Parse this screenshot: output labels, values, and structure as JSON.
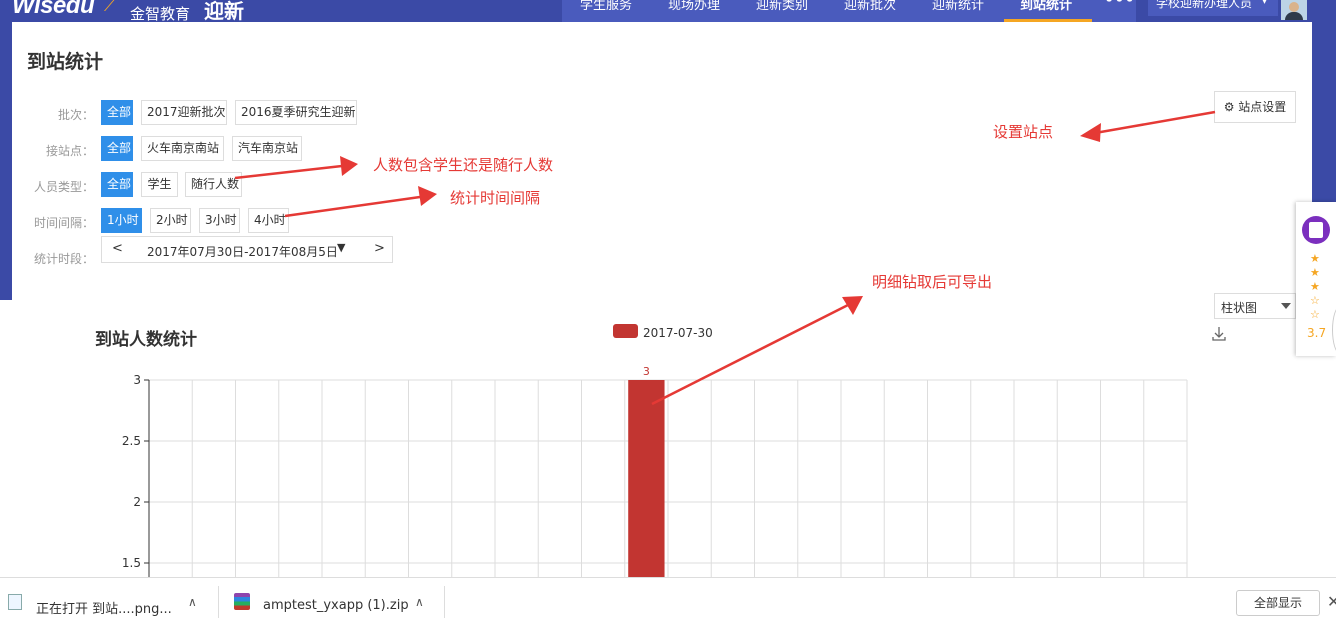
{
  "header": {
    "logo": "Wisedu",
    "logo_cn": "金智教育",
    "app_title": "迎新",
    "nav": [
      "学生服务",
      "现场办理",
      "迎新类别",
      "迎新批次",
      "迎新统计",
      "到站统计"
    ],
    "active_nav": "到站统计",
    "more": "•••",
    "user": "学校迎新办理人员",
    "user_caret": "▾"
  },
  "page": {
    "title": "到站统计",
    "filters": {
      "batch": {
        "label": "批次：",
        "options": [
          "全部",
          "2017迎新批次",
          "2016夏季研究生迎新"
        ],
        "selected": "全部"
      },
      "station": {
        "label": "接站点：",
        "options": [
          "全部",
          "火车南京南站",
          "汽车南京站"
        ],
        "selected": "全部"
      },
      "person_type": {
        "label": "人员类型：",
        "options": [
          "全部",
          "学生",
          "随行人数"
        ],
        "selected": "全部"
      },
      "interval": {
        "label": "时间间隔：",
        "options": [
          "1小时",
          "2小时",
          "3小时",
          "4小时"
        ],
        "selected": "1小时"
      },
      "period": {
        "label": "统计时段：",
        "prev": "<",
        "range": "2017年07月30日-2017年08月5日",
        "caret": "▼",
        "next": ">"
      }
    },
    "site_settings_button": "站点设置",
    "chart_type_select": "柱状图"
  },
  "annotations": {
    "site": "设置站点",
    "person_type": "人数包含学生还是随行人数",
    "interval": "统计时间间隔",
    "drill": "明细钻取后可导出"
  },
  "chart_data": {
    "type": "bar",
    "title": "到站人数统计",
    "legend": [
      "2017-07-30"
    ],
    "series": [
      {
        "name": "2017-07-30",
        "color": "#c23531",
        "values": [
          0,
          0,
          0,
          0,
          0,
          0,
          0,
          0,
          0,
          0,
          0,
          3,
          0,
          0,
          0,
          0,
          0,
          0,
          0,
          0,
          0,
          0,
          0,
          0
        ]
      }
    ],
    "y_ticks": [
      "3",
      "2.5",
      "2",
      "1.5"
    ],
    "ylim_visible": [
      1.5,
      3
    ],
    "data_labels": [
      "3"
    ],
    "grid": true
  },
  "side_widget": {
    "stars": [
      "★",
      "★",
      "★",
      "☆",
      "☆"
    ],
    "rating": "3.7"
  },
  "downloads": {
    "items": [
      {
        "text": "正在打开 到站....png...",
        "caret": "∧"
      },
      {
        "text": "amptest_yxapp (1).zip",
        "caret": "∧"
      }
    ],
    "show_all": "全部显示",
    "close": "✕"
  }
}
